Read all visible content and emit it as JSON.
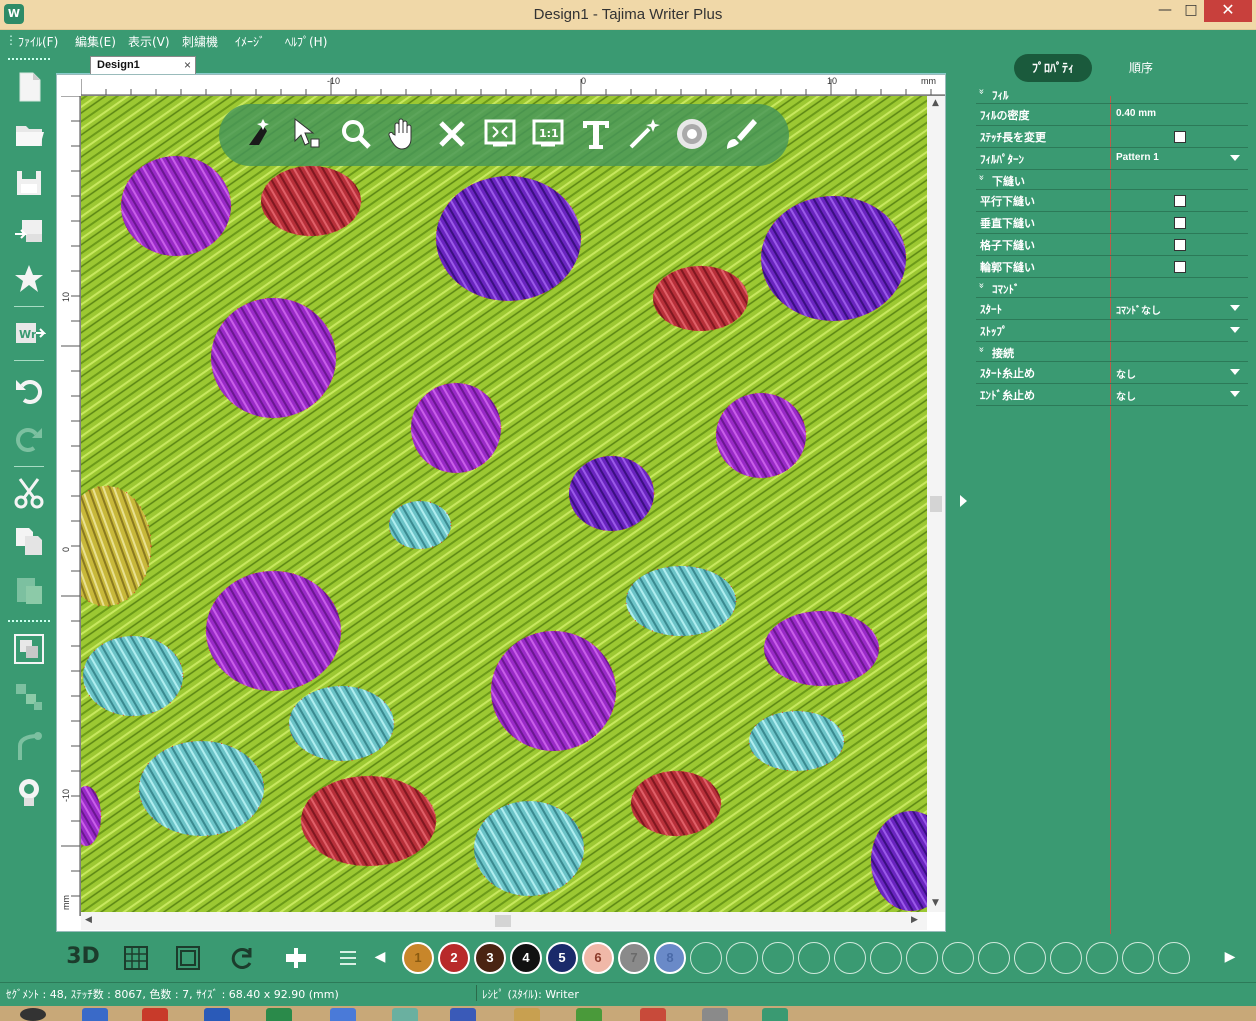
{
  "window": {
    "title": "Design1 - Tajima Writer Plus",
    "app_icon_text": "W",
    "minimize": "—",
    "maximize": "□",
    "close": "✕"
  },
  "menu": {
    "grip": "⋮",
    "items": [
      "ﾌｧｲﾙ(F)",
      "編集(E)",
      "表示(V)",
      "刺繍機",
      "ｲﾒｰｼﾞ",
      "ﾍﾙﾌﾟ(H)"
    ]
  },
  "left_toolbar": {
    "icons": [
      "new-document-icon",
      "open-folder-icon",
      "save-icon",
      "send-to-machine-icon",
      "star-shape-icon",
      "writer-export-icon",
      "undo-icon",
      "redo-icon",
      "cut-icon",
      "copy-icon",
      "paste-icon",
      "group-icon",
      "ungroup-icon",
      "branch-icon",
      "idea-bulb-icon"
    ]
  },
  "document": {
    "tab_label": "Design1",
    "tab_close": "×",
    "ruler_unit": "mm",
    "ruler_top_labels": [
      "-10",
      "0",
      "10"
    ],
    "ruler_left_labels": [
      "10",
      "0",
      "-10"
    ],
    "ruler_left_unit": "mm"
  },
  "canvas_toolbar": {
    "icons": [
      "auto-digitize-icon",
      "select-nodes-icon",
      "zoom-icon",
      "pan-hand-icon",
      "delete-icon",
      "fit-to-window-icon",
      "actual-size-icon",
      "text-tool-icon",
      "magic-wand-icon",
      "stitch-simulator-icon",
      "brush-icon"
    ]
  },
  "properties": {
    "tabs": [
      "ﾌﾟﾛﾊﾟﾃｨ",
      "順序"
    ],
    "rows": [
      {
        "kind": "section",
        "label": "ﾌｨﾙ"
      },
      {
        "kind": "text",
        "label": "ﾌｨﾙの密度",
        "value": "0.40 mm"
      },
      {
        "kind": "check",
        "label": "ｽﾃｯﾁ長を変更",
        "checked": false
      },
      {
        "kind": "dropdown",
        "label": "ﾌｨﾙﾊﾟﾀｰﾝ",
        "value": "Pattern 1"
      },
      {
        "kind": "section",
        "label": "下縫い"
      },
      {
        "kind": "check",
        "label": "平行下縫い",
        "checked": false
      },
      {
        "kind": "check",
        "label": "垂直下縫い",
        "checked": false
      },
      {
        "kind": "check",
        "label": "格子下縫い",
        "checked": false
      },
      {
        "kind": "check",
        "label": "輪郭下縫い",
        "checked": false
      },
      {
        "kind": "section",
        "label": "ｺﾏﾝﾄﾞ"
      },
      {
        "kind": "dropdown",
        "label": "ｽﾀｰﾄ",
        "value": "ｺﾏﾝﾄﾞなし"
      },
      {
        "kind": "dropdown",
        "label": "ｽﾄｯﾌﾟ",
        "value": ""
      },
      {
        "kind": "section",
        "label": "接続"
      },
      {
        "kind": "dropdown",
        "label": "ｽﾀｰﾄ糸止め",
        "value": "なし"
      },
      {
        "kind": "dropdown",
        "label": "ｴﾝﾄﾞ糸止め",
        "value": "なし"
      }
    ]
  },
  "bottom_toolbar": {
    "view_3d_label": "3D",
    "icons": [
      "grid-icon",
      "hoop-icon",
      "rotate-icon",
      "align-icon",
      "list-icon"
    ],
    "prev_arrow": "◀",
    "next_arrow": "▶",
    "colors": [
      {
        "num": "1",
        "hex": "#c8862a",
        "text": "#8a5a10"
      },
      {
        "num": "2",
        "hex": "#b82a2a",
        "text": "#ffffff"
      },
      {
        "num": "3",
        "hex": "#4a2412",
        "text": "#ffffff"
      },
      {
        "num": "4",
        "hex": "#111111",
        "text": "#ffffff"
      },
      {
        "num": "5",
        "hex": "#1a2a6a",
        "text": "#ffffff"
      },
      {
        "num": "6",
        "hex": "#f0b8a8",
        "text": "#8a3a2a"
      },
      {
        "num": "7",
        "hex": "#8a8a8a",
        "text": "#6a6a6a"
      },
      {
        "num": "8",
        "hex": "#6a8ac8",
        "text": "#4a6aa8"
      }
    ],
    "empty_slots": 14
  },
  "status": {
    "left": "ｾｸﾞﾒﾝﾄ : 48, ｽﾃｯﾁ数 : 8067, 色数 : 7, ｻｲｽﾞ : 68.40 x 92.90 (mm)",
    "right": "ﾚｼﾋﾟ (ｽﾀｲﾙ): Writer"
  },
  "colors": {
    "app_green": "#3a9a72",
    "title_bar": "#f0d8a8",
    "close_red": "#c8403c",
    "canvas_grass": "#8fbf2a",
    "purple_blob": "#9a2ac8",
    "red_blob": "#b8303a",
    "cyan_blob": "#6cc4c8",
    "yellow_blob": "#c8b83a"
  }
}
